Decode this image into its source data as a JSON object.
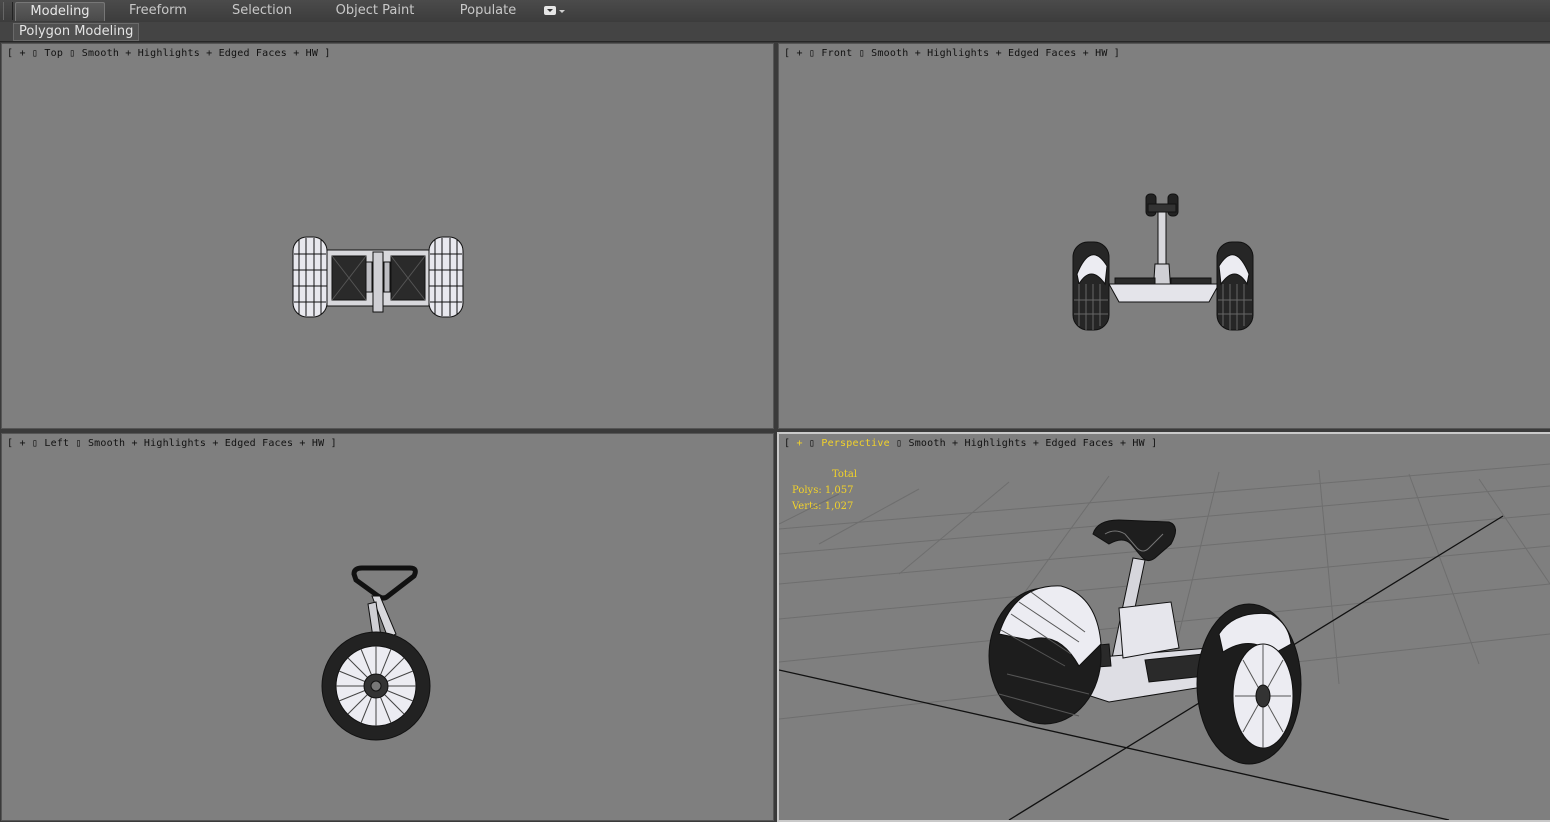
{
  "ribbon": {
    "tabs": [
      {
        "label": "Modeling",
        "active": true
      },
      {
        "label": "Freeform",
        "active": false
      },
      {
        "label": "Selection",
        "active": false
      },
      {
        "label": "Object Paint",
        "active": false
      },
      {
        "label": "Populate",
        "active": false
      }
    ],
    "panel_label": "Polygon Modeling",
    "dropdown_icon": "dropdown-icon"
  },
  "viewports": {
    "top": {
      "bracket_open": "[",
      "plus": "+",
      "view": "Top",
      "shading": "Smooth + Highlights + Edged Faces + HW",
      "bracket_close": "]"
    },
    "front": {
      "bracket_open": "[",
      "plus": "+",
      "view": "Front",
      "shading": "Smooth + Highlights + Edged Faces + HW",
      "bracket_close": "]"
    },
    "left": {
      "bracket_open": "[",
      "plus": "+",
      "view": "Left",
      "shading": "Smooth + Highlights + Edged Faces + HW",
      "bracket_close": "]"
    },
    "perspective": {
      "bracket_open": "[",
      "plus": "+",
      "view": "Perspective",
      "shading": "Smooth + Highlights + Edged Faces + HW",
      "bracket_close": "]"
    }
  },
  "stats": {
    "title": "Total",
    "polys_label": "Polys:",
    "polys_value": "1,057",
    "verts_label": "Verts:",
    "verts_value": "1,027"
  },
  "colors": {
    "viewport_bg": "#7f7f7f",
    "highlight": "#f2d22a",
    "ui_bg": "#3a3a3a"
  }
}
